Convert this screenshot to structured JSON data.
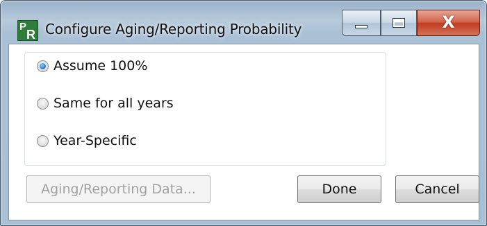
{
  "window": {
    "title": "Configure Aging/Reporting Probability",
    "app_icon": {
      "letter_top": "P",
      "letter_bottom": "R",
      "color": "#2f7d3a"
    },
    "controls": {
      "minimize_icon": "minimize-icon",
      "maximize_icon": "maximize-icon",
      "close_icon": "close-icon",
      "close_glyph": "X"
    }
  },
  "options": {
    "selected": "assume_100",
    "items": [
      {
        "id": "assume_100",
        "label": "Assume 100%",
        "checked": true
      },
      {
        "id": "same_all_years",
        "label": "Same for all years",
        "checked": false
      },
      {
        "id": "year_specific",
        "label": "Year-Specific",
        "checked": false
      }
    ]
  },
  "buttons": {
    "aging_data": {
      "label": "Aging/Reporting Data...",
      "enabled": false
    },
    "done": {
      "label": "Done",
      "enabled": true
    },
    "cancel": {
      "label": "Cancel",
      "enabled": true
    }
  },
  "colors": {
    "frame": "#a9bfd4",
    "close_button": "#c23b1f",
    "radio_selected": "#2d89d6",
    "disabled_text": "#a0a0a0"
  }
}
